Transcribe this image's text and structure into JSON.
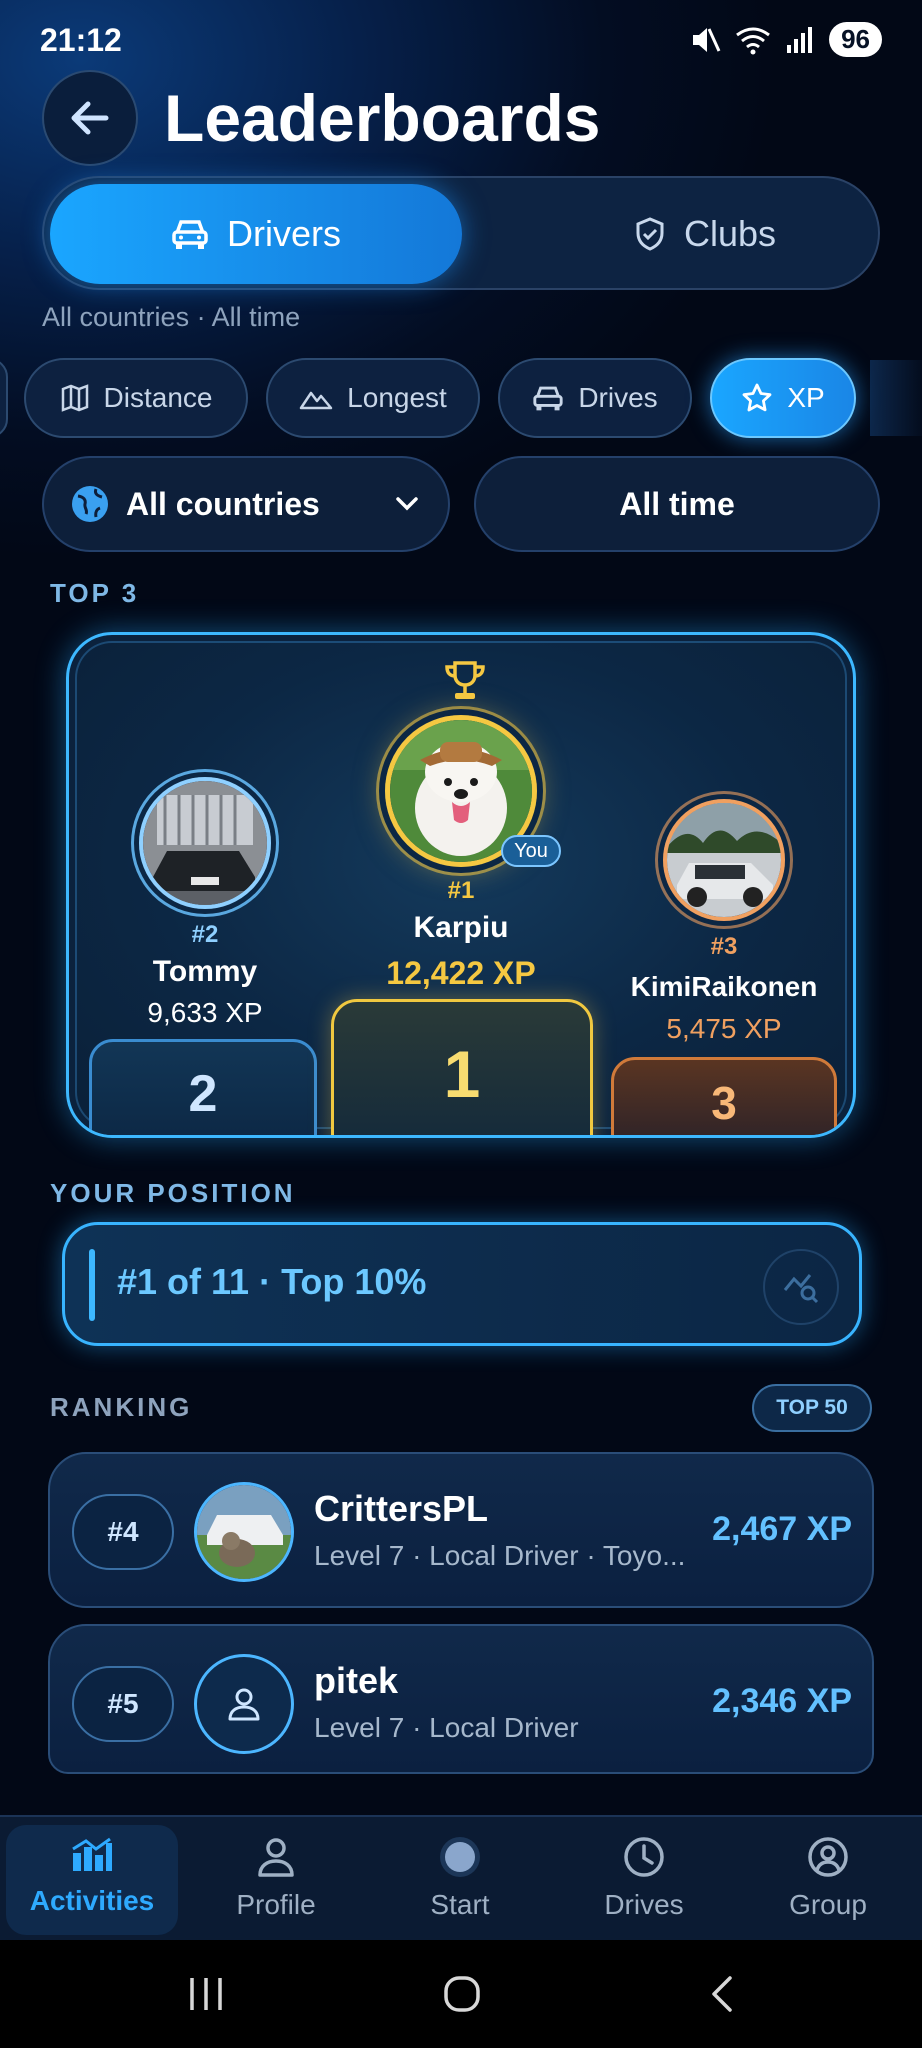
{
  "status_bar": {
    "time": "21:12",
    "battery": "96"
  },
  "header": {
    "title": "Leaderboards"
  },
  "segments": {
    "drivers": "Drivers",
    "clubs": "Clubs"
  },
  "filter_caption": "All countries · All time",
  "metric_chips": [
    {
      "label": "Distance",
      "icon": "map-icon"
    },
    {
      "label": "Longest",
      "icon": "mountain-icon"
    },
    {
      "label": "Drives",
      "icon": "car-icon"
    },
    {
      "label": "XP",
      "icon": "star-icon",
      "active": true
    }
  ],
  "filters": {
    "country": "All countries",
    "period": "All time"
  },
  "top3": {
    "label": "TOP 3",
    "first": {
      "rank": "#1",
      "name": "Karpiu",
      "xp": "12,422 XP",
      "badge": "You",
      "block": "1"
    },
    "second": {
      "rank": "#2",
      "name": "Tommy",
      "xp": "9,633 XP",
      "block": "2"
    },
    "third": {
      "rank": "#3",
      "name": "KimiRaikonen",
      "xp": "5,475 XP",
      "block": "3"
    }
  },
  "your_position": {
    "label": "YOUR POSITION",
    "text": "#1 of 11 · Top 10%"
  },
  "ranking": {
    "label": "RANKING",
    "badge": "TOP 50",
    "rows": [
      {
        "rank": "#4",
        "name": "CrittersPL",
        "sub": "Level 7 · Local Driver · Toyo...",
        "xp": "2,467 XP"
      },
      {
        "rank": "#5",
        "name": "pitek",
        "sub": "Level 7 · Local Driver",
        "xp": "2,346 XP"
      }
    ]
  },
  "nav": {
    "items": [
      {
        "label": "Activities",
        "icon": "chart-icon",
        "active": true
      },
      {
        "label": "Profile",
        "icon": "person-icon"
      },
      {
        "label": "Start",
        "icon": "start-dot-icon"
      },
      {
        "label": "Drives",
        "icon": "clock-icon"
      },
      {
        "label": "Group",
        "icon": "group-icon"
      }
    ]
  },
  "colors": {
    "accent": "#1aa6ff",
    "gold": "#f5c842",
    "bronze": "#f0a060"
  }
}
